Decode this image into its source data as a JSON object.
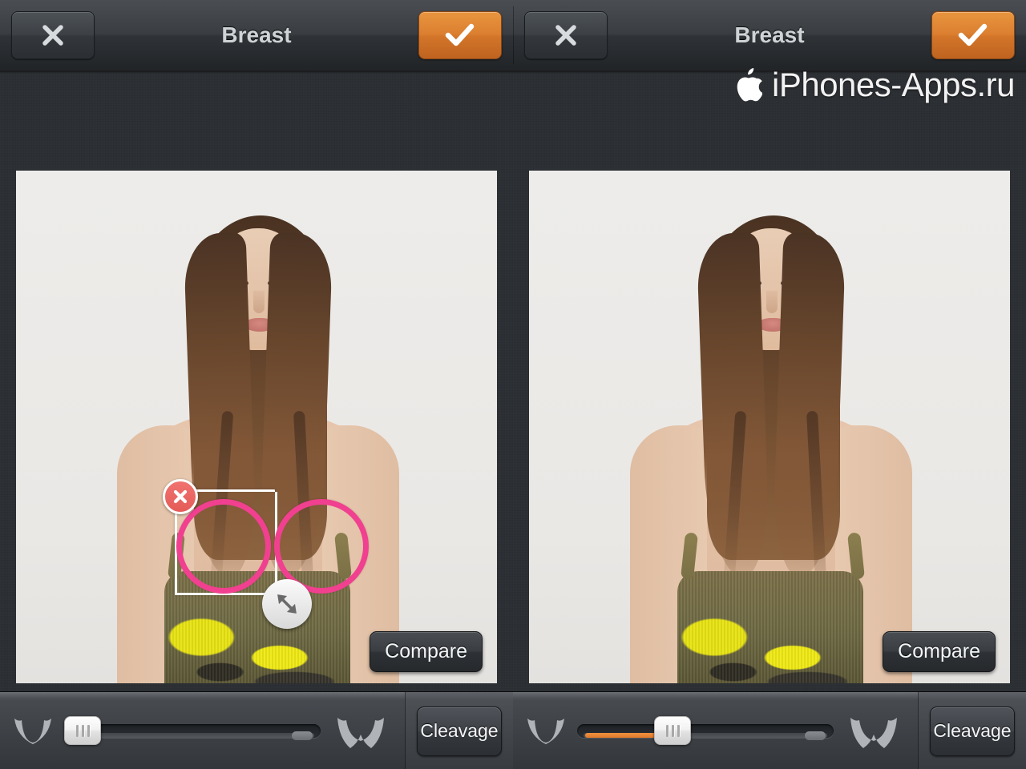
{
  "app": {
    "background_color": "#2a2e32",
    "accent_color": "#db7f30"
  },
  "watermark": {
    "icon": "apple-logo-icon",
    "text": "iPhones-Apps.ru"
  },
  "panels": [
    {
      "id": "left",
      "header": {
        "cancel_icon": "close-x-icon",
        "title": "Breast",
        "done_icon": "checkmark-icon"
      },
      "photo": {
        "compare_label": "Compare",
        "overlay_visible": true,
        "overlay": {
          "delete_icon": "close-x-circle-icon",
          "resize_icon": "diagonal-resize-arrow-icon",
          "circle_color": "#f0408f",
          "selection_border_color": "#ffffff",
          "delete_badge_color": "#e45c58"
        }
      },
      "toolbar": {
        "small_icon": "small-bra-icon",
        "large_icon": "large-bra-icon",
        "slider_value_percent": 0,
        "slider_fill_color": "#e07a2c",
        "cleavage_label": "Cleavage"
      }
    },
    {
      "id": "right",
      "header": {
        "cancel_icon": "close-x-icon",
        "title": "Breast",
        "done_icon": "checkmark-icon"
      },
      "photo": {
        "compare_label": "Compare",
        "overlay_visible": false
      },
      "toolbar": {
        "small_icon": "small-bra-icon",
        "large_icon": "large-bra-icon",
        "slider_value_percent": 35,
        "slider_fill_color": "#e07a2c",
        "cleavage_label": "Cleavage"
      }
    }
  ]
}
